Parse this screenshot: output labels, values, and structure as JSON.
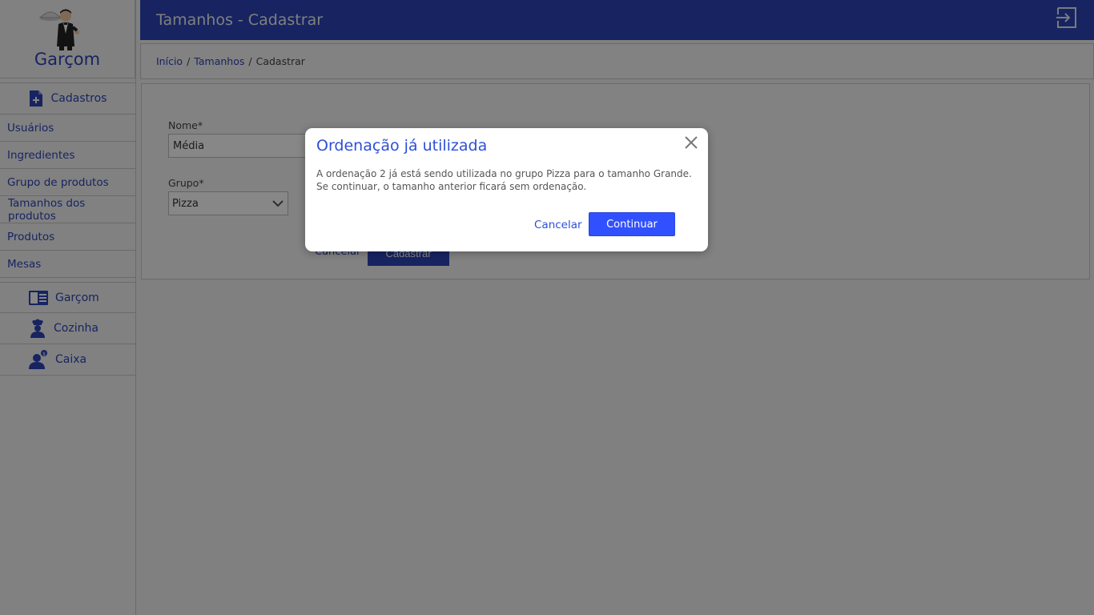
{
  "app": {
    "brand": "Garçom"
  },
  "sidebar": {
    "section_title": "Cadastros",
    "items": [
      {
        "label": "Usuários"
      },
      {
        "label": "Ingredientes"
      },
      {
        "label": "Grupo de produtos"
      },
      {
        "label": "Tamanhos dos produtos"
      },
      {
        "label": "Produtos"
      },
      {
        "label": "Mesas"
      }
    ],
    "modules": [
      {
        "label": "Garçom",
        "icon": "menu-card-icon"
      },
      {
        "label": "Cozinha",
        "icon": "chef-icon"
      },
      {
        "label": "Caixa",
        "icon": "cashier-icon"
      }
    ]
  },
  "header": {
    "title": "Tamanhos - Cadastrar"
  },
  "breadcrumb": {
    "home": "Início",
    "section": "Tamanhos",
    "current": "Cadastrar",
    "separator": "/"
  },
  "form": {
    "name_label": "Nome*",
    "name_value": "Média",
    "group_label": "Grupo*",
    "group_value": "Pizza",
    "cancel_label": "Cancelar",
    "submit_label": "Cadastrar"
  },
  "modal": {
    "title": "Ordenação já utilizada",
    "body_line1": "A ordenação 2 já está sendo utilizada no grupo Pizza para o tamanho Grande.",
    "body_line2": "Se continuar, o tamanho anterior ficará sem ordenação.",
    "cancel_label": "Cancelar",
    "continue_label": "Continuar"
  },
  "colors": {
    "primary": "#2d44b8",
    "modal_accent": "#3150ff"
  }
}
